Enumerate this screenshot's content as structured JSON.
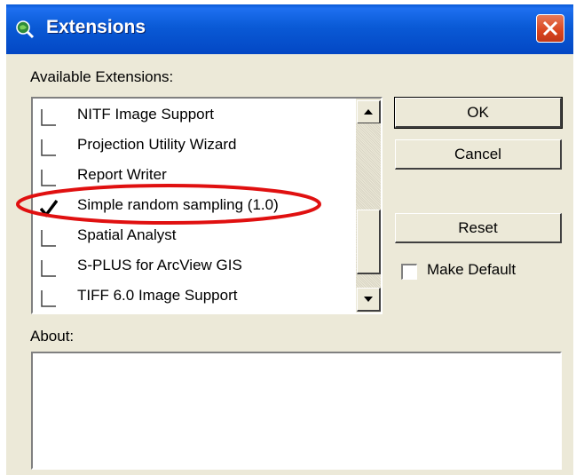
{
  "window": {
    "title": "Extensions"
  },
  "available_label": "Available Extensions:",
  "extensions": [
    {
      "label": "NITF Image Support",
      "checked": false
    },
    {
      "label": "Projection Utility Wizard",
      "checked": false
    },
    {
      "label": "Report Writer",
      "checked": false
    },
    {
      "label": "Simple random sampling (1.0)",
      "checked": true
    },
    {
      "label": "Spatial Analyst",
      "checked": false
    },
    {
      "label": "S-PLUS for ArcView GIS",
      "checked": false
    },
    {
      "label": "TIFF 6.0 Image Support",
      "checked": false
    }
  ],
  "buttons": {
    "ok": "OK",
    "cancel": "Cancel",
    "reset": "Reset"
  },
  "make_default": {
    "label": "Make Default",
    "checked": false
  },
  "about_label": "About:",
  "about_text": "",
  "icons": {
    "app": "globe-magnifier-icon",
    "close": "close-icon",
    "scroll_up": "arrow-up-icon",
    "scroll_down": "arrow-down-icon",
    "check": "checkmark-icon"
  },
  "colors": {
    "titlebar": "#0a5ad6",
    "window": "#ece9d8",
    "close": "#d9451e",
    "highlight": "#e01010"
  }
}
